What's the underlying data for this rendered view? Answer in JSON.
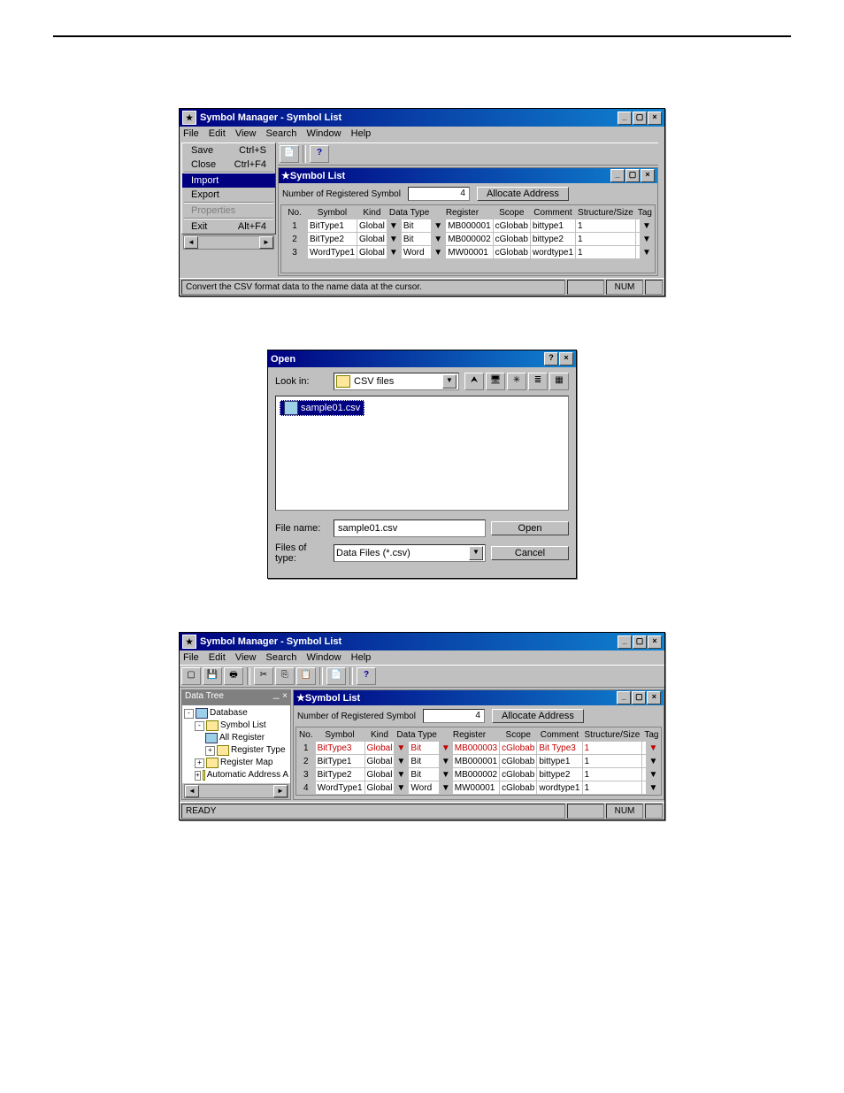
{
  "fig1": {
    "title": "Symbol Manager - Symbol List",
    "menus": [
      "File",
      "Edit",
      "View",
      "Search",
      "Window",
      "Help"
    ],
    "file_menu": [
      {
        "label": "Save",
        "accel": "Ctrl+S",
        "kind": "normal"
      },
      {
        "label": "Close",
        "accel": "Ctrl+F4",
        "kind": "normal"
      },
      {
        "label": "Import",
        "accel": "",
        "kind": "hl"
      },
      {
        "label": "Export",
        "accel": "",
        "kind": "normal"
      },
      {
        "label": "Properties",
        "accel": "",
        "kind": "dim"
      },
      {
        "label": "Exit",
        "accel": "Alt+F4",
        "kind": "normal"
      }
    ],
    "child_title": "Symbol List",
    "header_label": "Number of Registered Symbol",
    "count": "4",
    "alloc_btn": "Allocate Address",
    "columns": [
      "No.",
      "Symbol",
      "Kind",
      "Data Type",
      "Register",
      "Scope",
      "Comment",
      "Structure/Size",
      "Tag"
    ],
    "rows": [
      {
        "no": "1",
        "symbol": "BitType1",
        "kind": "Global",
        "dtype": "Bit",
        "reg": "MB000001",
        "scope": "cGlobab",
        "comment": "bittype1",
        "size": "1",
        "tag": ""
      },
      {
        "no": "2",
        "symbol": "BitType2",
        "kind": "Global",
        "dtype": "Bit",
        "reg": "MB000002",
        "scope": "cGlobab",
        "comment": "bittype2",
        "size": "1",
        "tag": ""
      },
      {
        "no": "3",
        "symbol": "WordType1",
        "kind": "Global",
        "dtype": "Word",
        "reg": "MW00001",
        "scope": "cGlobab",
        "comment": "wordtype1",
        "size": "1",
        "tag": ""
      }
    ],
    "status": "Convert the CSV format data to the name data at the cursor.",
    "num": "NUM"
  },
  "fig2": {
    "title": "Open",
    "lookin_label": "Look in:",
    "lookin_value": "CSV files",
    "file_selected": "sample01.csv",
    "filename_label": "File name:",
    "filename_value": "sample01.csv",
    "type_label": "Files of type:",
    "type_value": "Data Files (*.csv)",
    "open_btn": "Open",
    "cancel_btn": "Cancel"
  },
  "fig3": {
    "title": "Symbol Manager - Symbol List",
    "menus": [
      "File",
      "Edit",
      "View",
      "Search",
      "Window",
      "Help"
    ],
    "tree_title": "Data Tree",
    "tree": {
      "root": "Database",
      "symbol_list": "Symbol List",
      "all_register": "All Register",
      "register_type": "Register Type",
      "register_map": "Register Map",
      "auto_addr": "Automatic Address A"
    },
    "child_title": "Symbol List",
    "header_label": "Number of Registered Symbol",
    "count": "4",
    "alloc_btn": "Allocate Address",
    "columns": [
      "No.",
      "Symbol",
      "Kind",
      "Data Type",
      "Register",
      "Scope",
      "Comment",
      "Structure/Size",
      "Tag"
    ],
    "rows": [
      {
        "no": "1",
        "symbol": "BitType3",
        "kind": "Global",
        "dtype": "Bit",
        "reg": "MB000003",
        "scope": "cGlobab",
        "comment": "Bit Type3",
        "size": "1",
        "tag": "",
        "red": true
      },
      {
        "no": "2",
        "symbol": "BitType1",
        "kind": "Global",
        "dtype": "Bit",
        "reg": "MB000001",
        "scope": "cGlobab",
        "comment": "bittype1",
        "size": "1",
        "tag": ""
      },
      {
        "no": "3",
        "symbol": "BitType2",
        "kind": "Global",
        "dtype": "Bit",
        "reg": "MB000002",
        "scope": "cGlobab",
        "comment": "bittype2",
        "size": "1",
        "tag": ""
      },
      {
        "no": "4",
        "symbol": "WordType1",
        "kind": "Global",
        "dtype": "Word",
        "reg": "MW00001",
        "scope": "cGlobab",
        "comment": "wordtype1",
        "size": "1",
        "tag": ""
      }
    ],
    "status": "READY",
    "num": "NUM"
  }
}
